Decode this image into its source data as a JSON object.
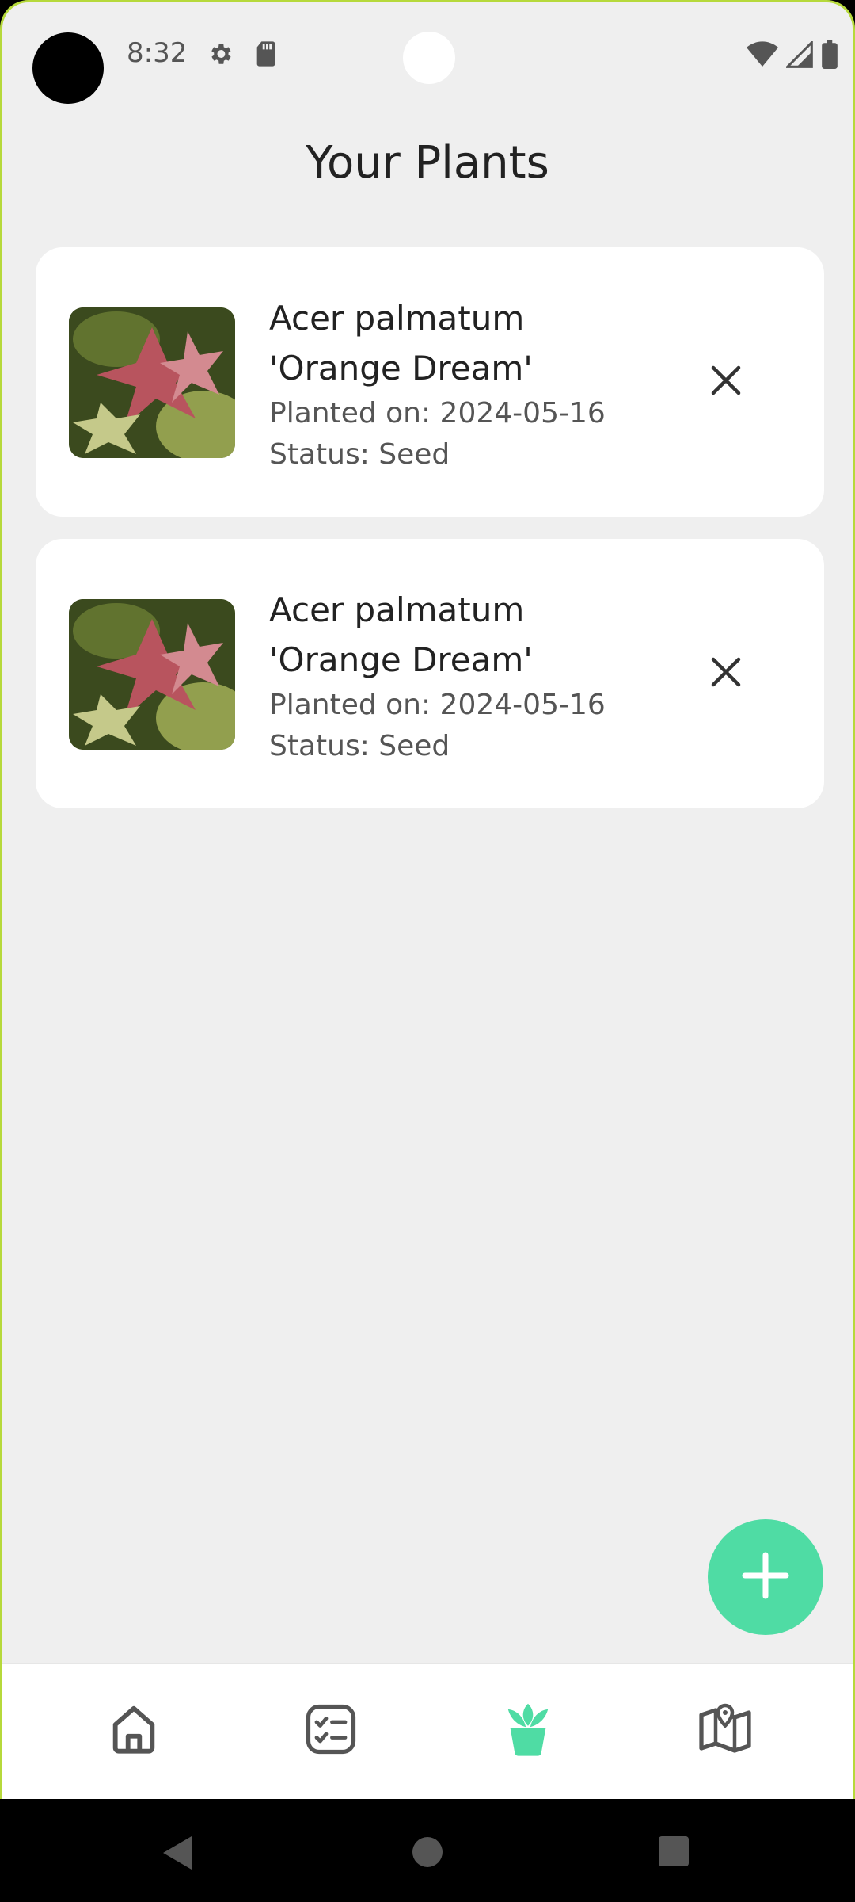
{
  "status_bar": {
    "time": "8:32"
  },
  "header": {
    "title": "Your Plants"
  },
  "plants": [
    {
      "name_line1": "Acer palmatum",
      "name_line2": "'Orange Dream'",
      "planted": "Planted on: 2024-05-16",
      "status": "Status: Seed"
    },
    {
      "name_line1": "Acer palmatum",
      "name_line2": "'Orange Dream'",
      "planted": "Planted on: 2024-05-16",
      "status": "Status: Seed"
    }
  ],
  "bottom_nav": {
    "items": [
      {
        "icon": "home-icon",
        "active": false
      },
      {
        "icon": "tasks-icon",
        "active": false
      },
      {
        "icon": "plant-pot-icon",
        "active": true
      },
      {
        "icon": "map-icon",
        "active": false
      }
    ]
  },
  "colors": {
    "accent": "#4fdca4",
    "frame": "#b6d93b",
    "background": "#efefef"
  }
}
